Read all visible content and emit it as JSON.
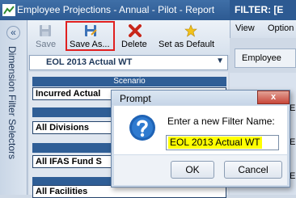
{
  "window": {
    "title": "Employee Projections - Annual - Pilot - Report",
    "filter_label": "FILTER: [E"
  },
  "sidebar": {
    "label": "Dimension Filter Selectors",
    "collapse_glyph": "«"
  },
  "toolbar": {
    "save_label": "Save",
    "save_as_label": "Save As...",
    "delete_label": "Delete",
    "set_default_label": "Set as Default"
  },
  "filter_select": {
    "selected": "EOL 2013 Actual WT"
  },
  "sections": [
    {
      "header": "Scenario",
      "value": "Incurred Actual"
    },
    {
      "header": "D",
      "value": "All Divisions"
    },
    {
      "header": "Fun",
      "value": "All IFAS Fund S"
    },
    {
      "header": "",
      "value": "All Facilities"
    }
  ],
  "right_panel": {
    "tabs": [
      "View",
      "Option"
    ],
    "field_value": "Employee",
    "list_items": [
      "E",
      "E",
      "E"
    ]
  },
  "dialog": {
    "title": "Prompt",
    "close_glyph": "x",
    "message": "Enter a new Filter Name:",
    "input_value": "EOL 2013 Actual WT",
    "ok_label": "OK",
    "cancel_label": "Cancel"
  },
  "colors": {
    "title_bar": "#2d5a92",
    "highlight_box": "#e02020",
    "input_highlight": "#ffff00",
    "section_header": "#2f5e96"
  }
}
